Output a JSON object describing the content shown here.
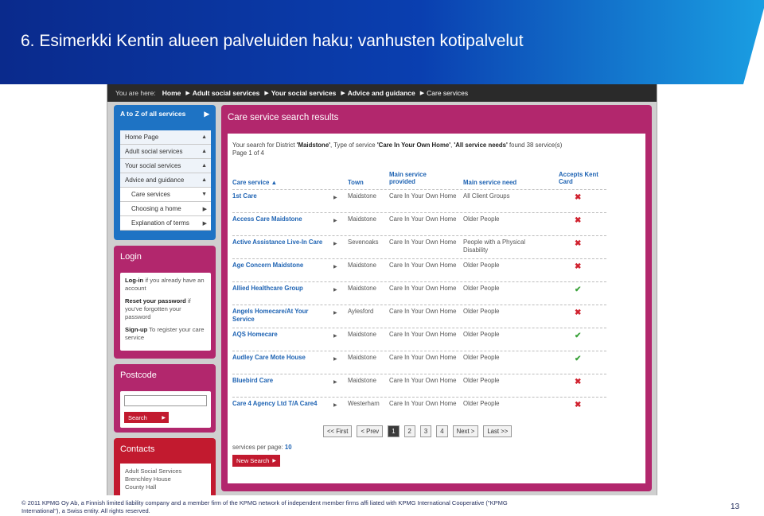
{
  "slide": {
    "title": "6. Esimerkki Kentin alueen palveluiden haku; vanhusten kotipalvelut",
    "footer": "© 2011 KPMG Oy Ab, a Finnish limited liability company and a member firm of the KPMG network of independent member firms affi liated with KPMG International Cooperative (\"KPMG International\"), a Swiss entity. All rights reserved.",
    "page_number": "13",
    "colors": {
      "header_dark": "#0a2a8c",
      "header_light": "#1a9ee2"
    }
  },
  "breadcrumb": {
    "label": "You are here:",
    "items": [
      "Home",
      "Adult social services",
      "Your social services",
      "Advice and guidance",
      "Care services"
    ]
  },
  "az_panel": {
    "title": "A to Z of all services",
    "items": [
      {
        "label": "Home Page",
        "icon": "caret-up-icon"
      },
      {
        "label": "Adult social services",
        "icon": "caret-up-icon"
      },
      {
        "label": "Your social services",
        "icon": "caret-up-icon"
      },
      {
        "label": "Advice and guidance",
        "icon": "caret-up-icon"
      },
      {
        "label": "Care services",
        "icon": "caret-down-icon"
      },
      {
        "label": "Choosing a home",
        "icon": "caret-right-icon"
      },
      {
        "label": "Explanation of terms",
        "icon": "caret-right-icon"
      }
    ]
  },
  "login_panel": {
    "title": "Login",
    "login_link": "Log-in",
    "login_text": "if you already have an account",
    "reset_link": "Reset your password",
    "reset_text": "if you've forgotten your password",
    "signup_link": "Sign-up",
    "signup_text": "To register your care service"
  },
  "postcode_panel": {
    "title": "Postcode",
    "input_value": "",
    "search_label": "Search"
  },
  "contacts_panel": {
    "title": "Contacts",
    "lines": [
      "Adult Social Services",
      "Brenchley House",
      "County Hall"
    ]
  },
  "results": {
    "title": "Care service search results",
    "summary_prefix": "Your search for District",
    "district": "'Maidstone'",
    "summary_mid": ", Type of service",
    "service_type": "'Care In Your Own Home'",
    "summary_sep": ",",
    "need": "'All service needs'",
    "summary_suffix": "found 38 service(s)",
    "page_info": "Page 1 of 4",
    "columns": {
      "care_service": "Care service ▲",
      "town": "Town",
      "main_service_provided": "Main service provided",
      "main_service_need": "Main service need",
      "accepts_kent_card": "Accepts Kent Card"
    },
    "rows": [
      {
        "name": "1st Care",
        "town": "Maidstone",
        "provided": "Care In Your Own Home",
        "need": "All Client Groups",
        "kent_card": "✖"
      },
      {
        "name": "Access Care Maidstone",
        "town": "Maidstone",
        "provided": "Care In Your Own Home",
        "need": "Older People",
        "kent_card": "✖"
      },
      {
        "name": "Active Assistance Live-In Care",
        "town": "Sevenoaks",
        "provided": "Care In Your Own Home",
        "need": "People with a Physical Disability",
        "kent_card": "✖"
      },
      {
        "name": "Age Concern Maidstone",
        "town": "Maidstone",
        "provided": "Care In Your Own Home",
        "need": "Older People",
        "kent_card": "✖"
      },
      {
        "name": "Allied Healthcare Group",
        "town": "Maidstone",
        "provided": "Care In Your Own Home",
        "need": "Older People",
        "kent_card": "✔"
      },
      {
        "name": "Angels Homecare/At Your Service",
        "town": "Aylesford",
        "provided": "Care In Your Own Home",
        "need": "Older People",
        "kent_card": "✖"
      },
      {
        "name": "AQS Homecare",
        "town": "Maidstone",
        "provided": "Care In Your Own Home",
        "need": "Older People",
        "kent_card": "✔"
      },
      {
        "name": "Audley Care Mote House",
        "town": "Maidstone",
        "provided": "Care In Your Own Home",
        "need": "Older People",
        "kent_card": "✔"
      },
      {
        "name": "Bluebird Care",
        "town": "Maidstone",
        "provided": "Care In Your Own Home",
        "need": "Older People",
        "kent_card": "✖"
      },
      {
        "name": "Care 4 Agency Ltd T/A Care4",
        "town": "Westerham",
        "provided": "Care In Your Own Home",
        "need": "Older People",
        "kent_card": "✖"
      }
    ],
    "pager": [
      "<< First",
      "< Prev",
      "1",
      "2",
      "3",
      "4",
      "Next >",
      "Last >>"
    ],
    "current_page": "1",
    "per_page_label": "services per page:",
    "per_page_value": "10",
    "new_search_label": "New Search"
  }
}
